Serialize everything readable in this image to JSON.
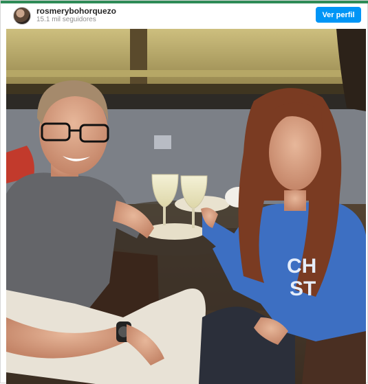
{
  "post": {
    "username": "rosmerybohorquezo",
    "followers": "15.1 mil seguidores",
    "view_profile_label": "Ver perfil"
  },
  "photo": {
    "shirt_text_line1": "CH",
    "shirt_text_line2": "ST"
  },
  "colors": {
    "accent": "#0095f6",
    "top_strip": "#2e8b57"
  }
}
